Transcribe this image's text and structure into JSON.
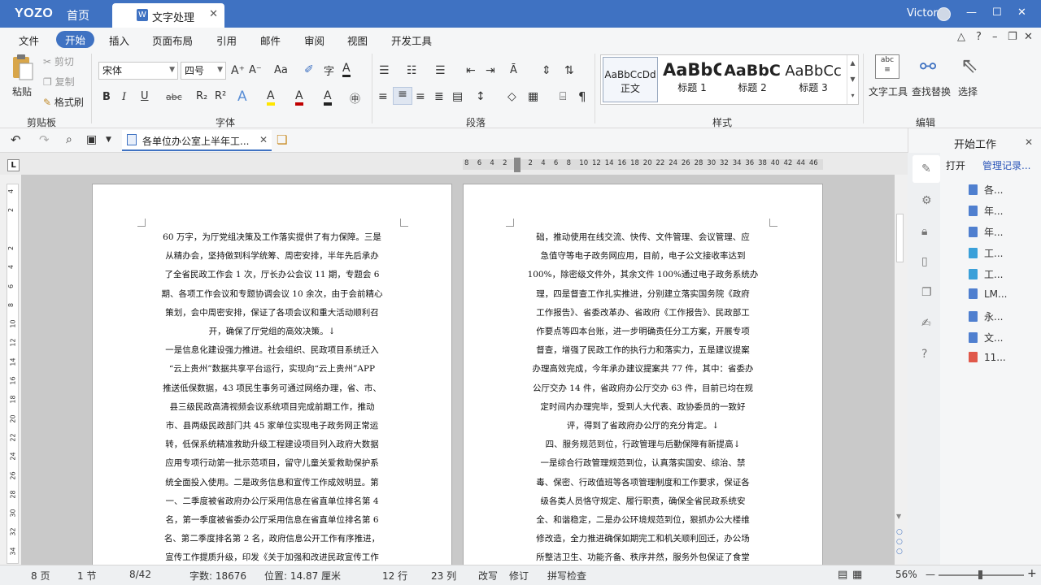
{
  "titlebar": {
    "brand": "YOZO",
    "home": "首页",
    "tab": "文字处理",
    "tab_icon": "W",
    "tab_close": "✕",
    "user": "Victor",
    "minimize": "—",
    "maximize": "☐",
    "close": "✕"
  },
  "menubar": {
    "items": [
      "文件",
      "开始",
      "插入",
      "页面布局",
      "引用",
      "邮件",
      "审阅",
      "视图",
      "开发工具"
    ],
    "active": "开始",
    "help": "?"
  },
  "ribbon": {
    "clipboard": {
      "paste": "粘贴",
      "cut": "剪切",
      "copy": "复制",
      "format_painter": "格式刷",
      "label": "剪贴板"
    },
    "font": {
      "family": "宋体",
      "size": "四号",
      "aa": "Aa",
      "label": "字体",
      "bold": "B",
      "italic": "I",
      "underline": "U",
      "strike": "abc",
      "subscript": "R₂",
      "superscript": "R²",
      "font_color": "A",
      "highlight": "A",
      "char_border": "A",
      "grow": "A⁺",
      "shrink": "A⁻"
    },
    "paragraph": {
      "label": "段落",
      "pilcrow": "¶"
    },
    "styles": {
      "label": "样式",
      "items": [
        {
          "preview": "AaBbCcDd",
          "name": "正文"
        },
        {
          "preview": "AaBbC",
          "name": "标题 1"
        },
        {
          "preview": "AaBbC",
          "name": "标题 2"
        },
        {
          "preview": "AaBbCc",
          "name": "标题 3"
        }
      ]
    },
    "editing": {
      "text_tools": "文字工具",
      "find_replace": "查找替换",
      "select": "选择",
      "label": "编辑"
    }
  },
  "quickbar": {
    "file_tab": "各单位办公室上半年工...",
    "file_close": "✕"
  },
  "ruler": {
    "ticks": [
      "8",
      "6",
      "4",
      "2",
      "",
      "2",
      "4",
      "6",
      "8",
      "10",
      "12",
      "14",
      "16",
      "18",
      "20",
      "22",
      "24",
      "26",
      "28",
      "30",
      "32",
      "34",
      "36",
      "38",
      "40",
      "42",
      "44",
      "46"
    ],
    "vticks": [
      "4",
      "2",
      "",
      "2",
      "4",
      "6",
      "8",
      "10",
      "12",
      "14",
      "16",
      "18",
      "20",
      "22",
      "24",
      "26",
      "28",
      "30",
      "32",
      "34"
    ]
  },
  "document": {
    "page_left": [
      "60 万字，为厅党组决策及工作落实提供了有力保障。三是",
      "从精办会，坚持做到科学统筹、周密安排，半年先后承办",
      "了全省民政工作会 1 次，厅长办公会议 11 期，专题会 6",
      "期、各项工作会议和专题协调会议 10 余次，由于会前精心",
      "策划，会中周密安排，保证了各项会议和重大活动顺利召",
      "开，确保了厅党组的高效决策。↓",
      "一是信息化建设强力推进。社会组织、民政项目系统迁入",
      "“云上贵州”数据共享平台运行，实现向“云上贵州”APP",
      "推送低保数据，43 项民生事务可通过网络办理，省、市、",
      "县三级民政高清视频会议系统项目完成前期工作，推动",
      "市、县两级民政部门共 45 家单位实现电子政务网正常运",
      "转，低保系统精准救助升级工程建设项目列入政府大数据",
      "应用专项行动第一批示范项目，留守儿童关爱救助保护系",
      "统全面投入使用。二是政务信息和宣传工作成效明显。第",
      "一、二季度被省政府办公厅采用信息在省直单位排名第 4",
      "名，第一季度被省委办公厅采用信息在省直单位排名第 6",
      "名、第二季度排名第 2 名，政府信息公开工作有序推进，",
      "宣传工作提质升级，印发《关于加强和改进民政宣传工作"
    ],
    "page_right": [
      "础，推动使用在线交流、快传、文件管理、会议管理、应",
      "急值守等电子政务网应用，目前，电子公文接收率达到",
      "100%，除密级文件外，其余文件 100%通过电子政务系统办",
      "理，四是督查工作扎实推进，分别建立落实国务院《政府",
      "工作报告》、省委改革办、省政府《工作报告》、民政部工",
      "作要点等四本台账，进一步明确责任分工方案，开展专项",
      "督查，增强了民政工作的执行力和落实力，五是建议提案",
      "办理高效完成，今年承办建议提案共 77 件，其中：省委办",
      "公厅交办 14 件，省政府办公厅交办 63 件，目前已均在规",
      "定时间内办理完毕，受到人大代表、政协委员的一致好",
      "评，得到了省政府办公厅的充分肯定。↓",
      "四、服务规范到位，行政管理与后勤保障有新提高↓",
      "一是综合行政管理规范到位，认真落实国安、综治、禁",
      "毒、保密、行政值班等各项管理制度和工作要求，保证各",
      "级各类人员恪守规定、履行职责，确保全省民政系统安",
      "全、和谐稳定，二是办公环境规范到位，狠抓办公大楼维",
      "修改造，全力推进确保如期完工和机关顺利回迁，办公场",
      "所整洁卫生、功能齐备、秩序井然，服务外包保证了食堂"
    ]
  },
  "right_panel": {
    "title": "开始工作",
    "close": "✕",
    "open": "打开",
    "manage": "管理记录...",
    "files": [
      {
        "name": "各...",
        "type": "doc"
      },
      {
        "name": "年...",
        "type": "doc"
      },
      {
        "name": "年...",
        "type": "doc"
      },
      {
        "name": "工...",
        "type": "o"
      },
      {
        "name": "工...",
        "type": "o"
      },
      {
        "name": "LM...",
        "type": "doc"
      },
      {
        "name": "永...",
        "type": "doc"
      },
      {
        "name": "文...",
        "type": "doc"
      },
      {
        "name": "11...",
        "type": "pdf"
      }
    ]
  },
  "status": {
    "pages": "8 页",
    "section": "1 节",
    "page_of": "8/42",
    "words": "字数: 18676",
    "position": "位置: 14.87 厘米",
    "row": "12 行",
    "col": "23 列",
    "overwrite": "改写",
    "track": "修订",
    "spell": "拼写检查",
    "zoom": "56%",
    "zoom_minus": "—",
    "zoom_plus": "+"
  },
  "colors": {
    "accent": "#3f72c2",
    "font_red": "#c00000",
    "highlight_yellow": "#ffe600"
  }
}
